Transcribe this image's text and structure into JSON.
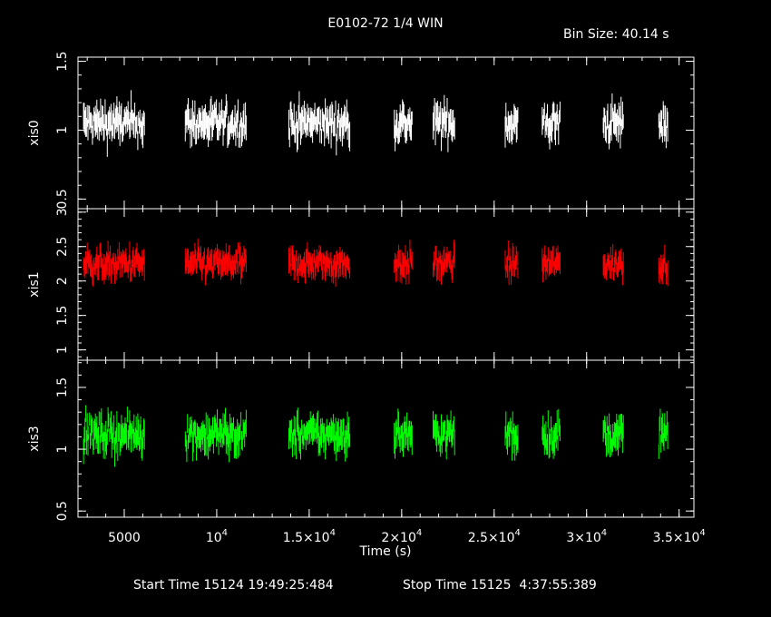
{
  "title": "E0102-72 1/4 WIN",
  "bin_size": "Bin Size: 40.14 s",
  "footer": {
    "start": "Start Time 15124 19:49:25:484",
    "stop": "Stop Time 15125  4:37:55:389"
  },
  "colors": {
    "background": "#000000",
    "axis": "#ffffff",
    "xis0": "#ffffff",
    "xis1": "#ff0000",
    "xis3": "#00ff00"
  },
  "chart_data": {
    "type": "scatter",
    "xlabel": "Time (s)",
    "xlim": [
      2500,
      35800
    ],
    "x_ticks": [
      {
        "value": 5000,
        "label": "5000"
      },
      {
        "value": 10000,
        "label": "10^4"
      },
      {
        "value": 15000,
        "label": "1.5×10^4"
      },
      {
        "value": 20000,
        "label": "2×10^4"
      },
      {
        "value": 25000,
        "label": "2.5×10^4"
      },
      {
        "value": 30000,
        "label": "3×10^4"
      },
      {
        "value": 35000,
        "label": "3.5×10^4"
      }
    ],
    "segments": [
      [
        2800,
        6100
      ],
      [
        8300,
        11600
      ],
      [
        13900,
        17200
      ],
      [
        19600,
        20600
      ],
      [
        21700,
        22900
      ],
      [
        25600,
        26300
      ],
      [
        27600,
        28600
      ],
      [
        30900,
        32000
      ],
      [
        33900,
        34400
      ]
    ],
    "panels": [
      {
        "name": "xis0",
        "ylabel": "xis0",
        "color": "#ffffff",
        "ylim": [
          0.43,
          1.53
        ],
        "y_ticks": [
          {
            "value": 0.5,
            "label": "0.5"
          },
          {
            "value": 1,
            "label": "1"
          },
          {
            "value": 1.5,
            "label": "1.5"
          }
        ],
        "mean": 1.05,
        "scatter": 0.14
      },
      {
        "name": "xis1",
        "ylabel": "xis1",
        "color": "#ff0000",
        "ylim": [
          0.85,
          3.05
        ],
        "y_ticks": [
          {
            "value": 1,
            "label": "1"
          },
          {
            "value": 1.5,
            "label": "1.5"
          },
          {
            "value": 2,
            "label": "2"
          },
          {
            "value": 2.5,
            "label": "2.5"
          },
          {
            "value": 3,
            "label": "3"
          }
        ],
        "mean": 2.25,
        "scatter": 0.22
      },
      {
        "name": "xis3",
        "ylabel": "xis3",
        "color": "#00ff00",
        "ylim": [
          0.45,
          1.72
        ],
        "y_ticks": [
          {
            "value": 0.5,
            "label": "0.5"
          },
          {
            "value": 1,
            "label": "1"
          },
          {
            "value": 1.5,
            "label": "1.5"
          }
        ],
        "mean": 1.12,
        "scatter": 0.15
      }
    ]
  }
}
